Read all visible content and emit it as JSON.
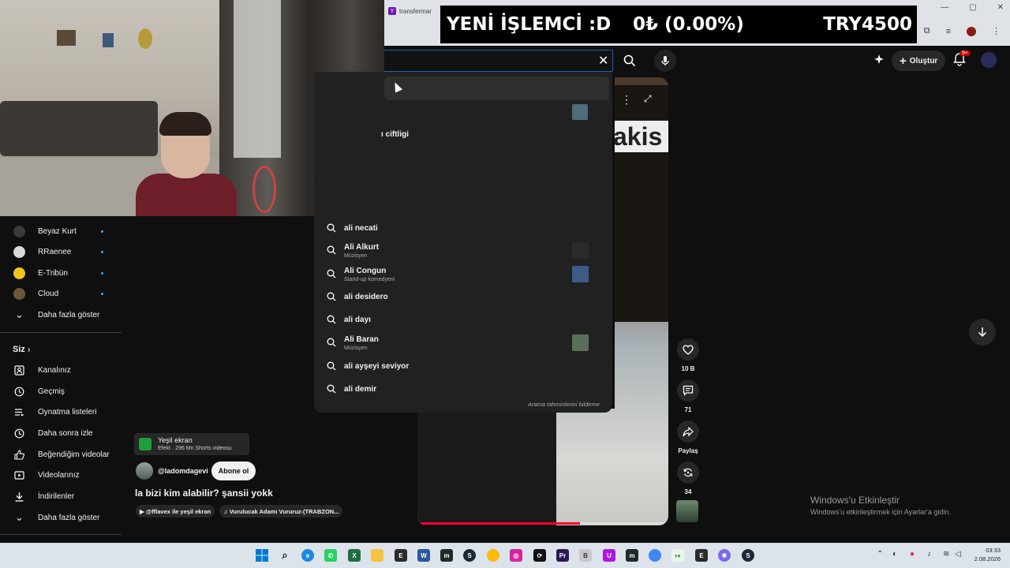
{
  "browser": {
    "tab_title": "transfermar",
    "window_buttons": [
      "—",
      "▢",
      "✕"
    ]
  },
  "ticker": {
    "label": "YENİ İŞLEMCİ :D",
    "change": "0₺ (0.00%)",
    "price": "TRY4500"
  },
  "header": {
    "create_label": "Oluştur",
    "notif_count": "9+"
  },
  "sidebar": {
    "channels": [
      {
        "label": "Beyaz Kurt",
        "color": "#3a3a3a"
      },
      {
        "label": "RRaenee",
        "color": "#d9d9d9"
      },
      {
        "label": "E-Tribün",
        "color": "#f0c419"
      },
      {
        "label": "Cloud",
        "color": "#6b5a3a"
      }
    ],
    "show_more_1": "Daha fazla göster",
    "you_label": "Siz",
    "you_items": [
      "Kanalınız",
      "Geçmiş",
      "Oynatma listeleri",
      "Daha sonra izle",
      "Beğendiğim videolar",
      "Videolarınız",
      "İndirilenler"
    ],
    "show_more_2": "Daha fazla göster"
  },
  "dropdown": {
    "partial_item": "ı ciftligi",
    "suggestions": [
      {
        "main": "ali necati",
        "sub": ""
      },
      {
        "main": "Ali Alkurt",
        "sub": "Müzisyen"
      },
      {
        "main": "Ali Congun",
        "sub": "Stand-up komedyeni"
      },
      {
        "main": "ali desidero",
        "sub": ""
      },
      {
        "main": "ali dayı",
        "sub": ""
      },
      {
        "main": "Ali Baran",
        "sub": "Müzisyen"
      },
      {
        "main": "ali ayşeyi seviyor",
        "sub": ""
      },
      {
        "main": "ali demir",
        "sub": ""
      }
    ],
    "report_label": "Arama tahminlerini bildirme"
  },
  "video": {
    "sign_text": "akis",
    "effect_title": "Yeşil ekran",
    "effect_sub": "Efekt · 296 Mn Shorts videosu",
    "channel": "@ladomdagevi",
    "subscribe_label": "Abone ol",
    "title": "la bizi kim alabilir? şansii yokk",
    "tags": [
      "▶ @fflavex ile yeşil ekran",
      "♫ Vurulucak Adamı Vururuz-(TRABZON..."
    ],
    "progress": 0.65
  },
  "actions": {
    "likes": "10 B",
    "comments": "71",
    "share_label": "Paylaş",
    "remix": "34"
  },
  "activation": {
    "title": "Windows'u Etkinleştir",
    "subtitle": "Windows'u etkinleştirmek için Ayarlar'a gidin."
  },
  "taskbar": {
    "time": "03:33",
    "date": "2.08.2026"
  }
}
